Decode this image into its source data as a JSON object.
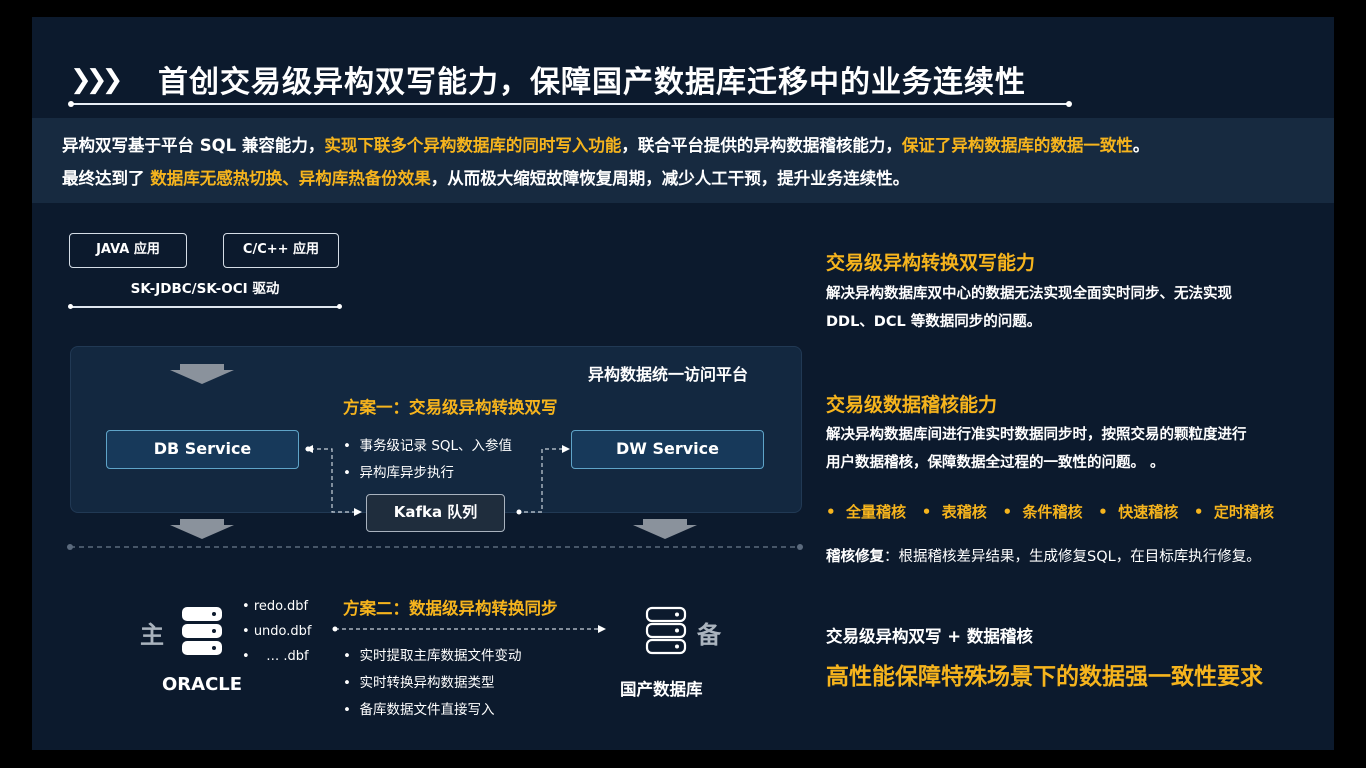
{
  "header": {
    "chevrons": "❯❯❯",
    "title": "首创交易级异构双写能力，保障国产数据库迁移中的业务连续性"
  },
  "intro": {
    "line1": [
      {
        "t": "异构双写基于平台 SQL 兼容能力，",
        "hl": false
      },
      {
        "t": "实现下联多个异构数据库的同时写入功能",
        "hl": true
      },
      {
        "t": "，联合平台提供的异构数据稽核能力，",
        "hl": false
      },
      {
        "t": "保证了异构数据库的数据一致性",
        "hl": true
      },
      {
        "t": "。",
        "hl": false
      }
    ],
    "line2": [
      {
        "t": "最终达到了 ",
        "hl": false
      },
      {
        "t": "数据库无感热切换、异构库热备份效果",
        "hl": true
      },
      {
        "t": "，从而极大缩短故障恢复周期，减少人工干预，提升业务连续性。",
        "hl": false
      }
    ]
  },
  "diagram": {
    "java_app": "JAVA 应用",
    "c_app": "C/C++ 应用",
    "driver": "SK-JDBC/SK-OCI 驱动",
    "platform_title": "异构数据统一访问平台",
    "plan1": "方案一：交易级异构转换双写",
    "db_service": "DB Service",
    "dw_service": "DW Service",
    "kafka": "Kafka 队列",
    "plan1_items": [
      "事务级记录 SQL、入参值",
      "异构库异步执行"
    ],
    "plan2": "方案二：数据级异构转换同步",
    "primary_label": "主",
    "oracle": "ORACLE",
    "files": [
      "redo.dbf",
      "undo.dbf",
      "… .dbf"
    ],
    "plan2_items": [
      "实时提取主库数据文件变动",
      "实时转换异构数据类型",
      "备库数据文件直接写入"
    ],
    "backup_label": "备",
    "domestic_db": "国产数据库"
  },
  "right": {
    "h1": "交易级异构转换双写能力",
    "p1": [
      "解决异构数据库双中心的数据无法实现全面实时同步、无法实现",
      "DDL、DCL 等数据同步的问题。"
    ],
    "h2": "交易级数据稽核能力",
    "p2": [
      "解决异构数据库间进行准实时数据同步时，按照交易的颗粒度进行",
      "用户数据稽核，保障数据全过程的一致性的问题。 。"
    ],
    "checks": [
      "全量稽核",
      "表稽核",
      "条件稽核",
      "快速稽核",
      "定时稽核"
    ],
    "repair_label": "稽核修复",
    "repair_text": "：根据稽核差异结果，生成修复SQL，在目标库执行修复。",
    "summary": "交易级异构双写 + 数据稽核",
    "conclusion": "高性能保障特殊场景下的数据强一致性要求"
  }
}
